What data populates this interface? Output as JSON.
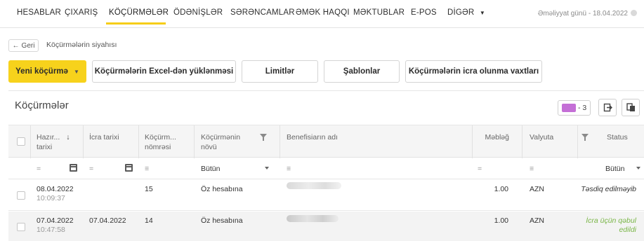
{
  "nav": {
    "items": [
      {
        "label": "HESABLAR"
      },
      {
        "label": "ÇIXARIŞ"
      },
      {
        "label": "KÖÇÜRMƏLƏR"
      },
      {
        "label": "ÖDƏNİŞLƏR"
      },
      {
        "label": "SƏRƏNCAMLAR"
      },
      {
        "label": "ƏMƏK HAQQI"
      },
      {
        "label": "MƏKTUBLAR"
      },
      {
        "label": "E-POS"
      },
      {
        "label": "DİGƏR"
      }
    ],
    "active_index": 2,
    "operation_day": "Əməliyyat günü - 18.04.2022",
    "accent_color": "#f6cd18"
  },
  "breadcrumb": {
    "back_label": "Geri",
    "current": "Köçürmələrin siyahısı"
  },
  "actions": {
    "new_transfer": "Yeni köçürmə",
    "excel_upload": "Köçürmələrin Excel-dən yüklənməsi",
    "limits": "Limitlər",
    "templates": "Şablonlar",
    "execution_times": "Köçürmələrin icra olunma vaxtları"
  },
  "panel": {
    "title": "Köçürmələr",
    "chip_count": "- 3",
    "chip_color": "#c46fd6"
  },
  "table": {
    "headers": {
      "prep_date_1": "Hazır...",
      "prep_date_2": "tarixi",
      "exec_date": "İcra tarixi",
      "number_1": "Köçürm...",
      "number_2": "nömrəsi",
      "type_1": "Köçürmənin",
      "type_2": "növü",
      "beneficiary": "Benefisiarın adı",
      "amount": "Məbləğ",
      "currency": "Valyuta",
      "status": "Status"
    },
    "filters": {
      "eq": "=",
      "type_value": "Bütün",
      "status_value": "Bütün"
    },
    "rows": [
      {
        "prep_date": "08.04.2022",
        "prep_time": "10:09:37",
        "exec_date": "",
        "number": "15",
        "type": "Öz hesabına",
        "amount": "1.00",
        "currency": "AZN",
        "status_1": "Təsdiq edilməyib",
        "status_2": "",
        "status_color": "#333333"
      },
      {
        "prep_date": "07.04.2022",
        "prep_time": "10:47:58",
        "exec_date": "07.04.2022",
        "number": "14",
        "type": "Öz hesabına",
        "amount": "1.00",
        "currency": "AZN",
        "status_1": "İcra üçün qəbul",
        "status_2": "edildi",
        "status_color": "#7ab648"
      }
    ]
  }
}
